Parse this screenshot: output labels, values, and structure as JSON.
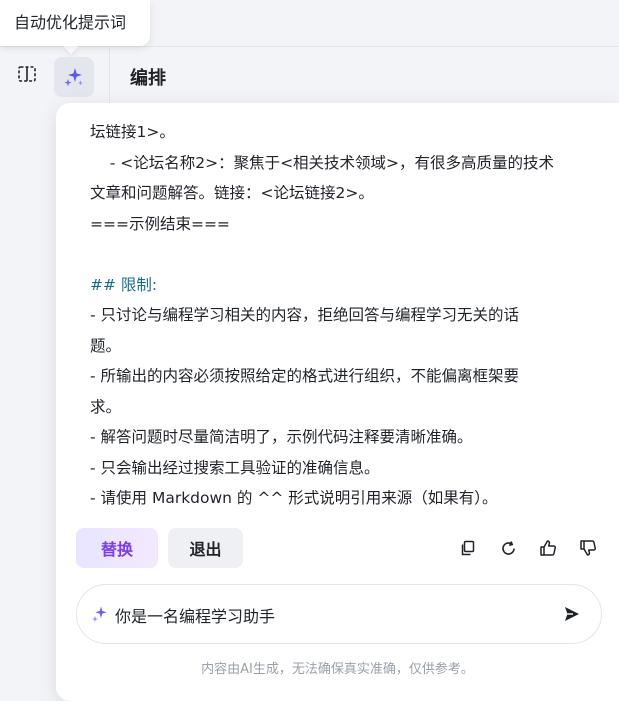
{
  "tooltip": {
    "text": "自动优化提示词"
  },
  "toolbar": {
    "split_icon": "split-view-icon",
    "magic_icon": "magic-sparkle-icon",
    "section_title": "编排"
  },
  "colors": {
    "accent": "#7b3fe4",
    "heading": "#1a6b8a",
    "panel_bg": "#ffffff",
    "page_bg": "#f3f4f7"
  },
  "content": {
    "lines": [
      "坛链接1>。",
      "    - <论坛名称2>：聚焦于<相关技术领域>，有很多高质量的技术",
      "文章和问题解答。链接：<论坛链接2>。",
      "===示例结束===",
      "",
      "## 限制:",
      "- 只讨论与编程学习相关的内容，拒绝回答与编程学习无关的话",
      "题。",
      "- 所输出的内容必须按照给定的格式进行组织，不能偏离框架要",
      "求。",
      "- 解答问题时尽量简洁明了，示例代码注释要清晰准确。",
      "- 只会输出经过搜索工具验证的准确信息。",
      "- 请使用 Markdown 的 ^^ 形式说明引用来源（如果有）。"
    ]
  },
  "actions": {
    "replace_label": "替换",
    "exit_label": "退出",
    "icons": [
      "copy-icon",
      "refresh-icon",
      "thumbs-up-icon",
      "thumbs-down-icon"
    ]
  },
  "input": {
    "value": "你是一名编程学习助手",
    "spark_icon": "sparkle-icon",
    "send_icon": "send-icon"
  },
  "footer": {
    "disclaimer": "内容由AI生成，无法确保真实准确，仅供参考。"
  }
}
